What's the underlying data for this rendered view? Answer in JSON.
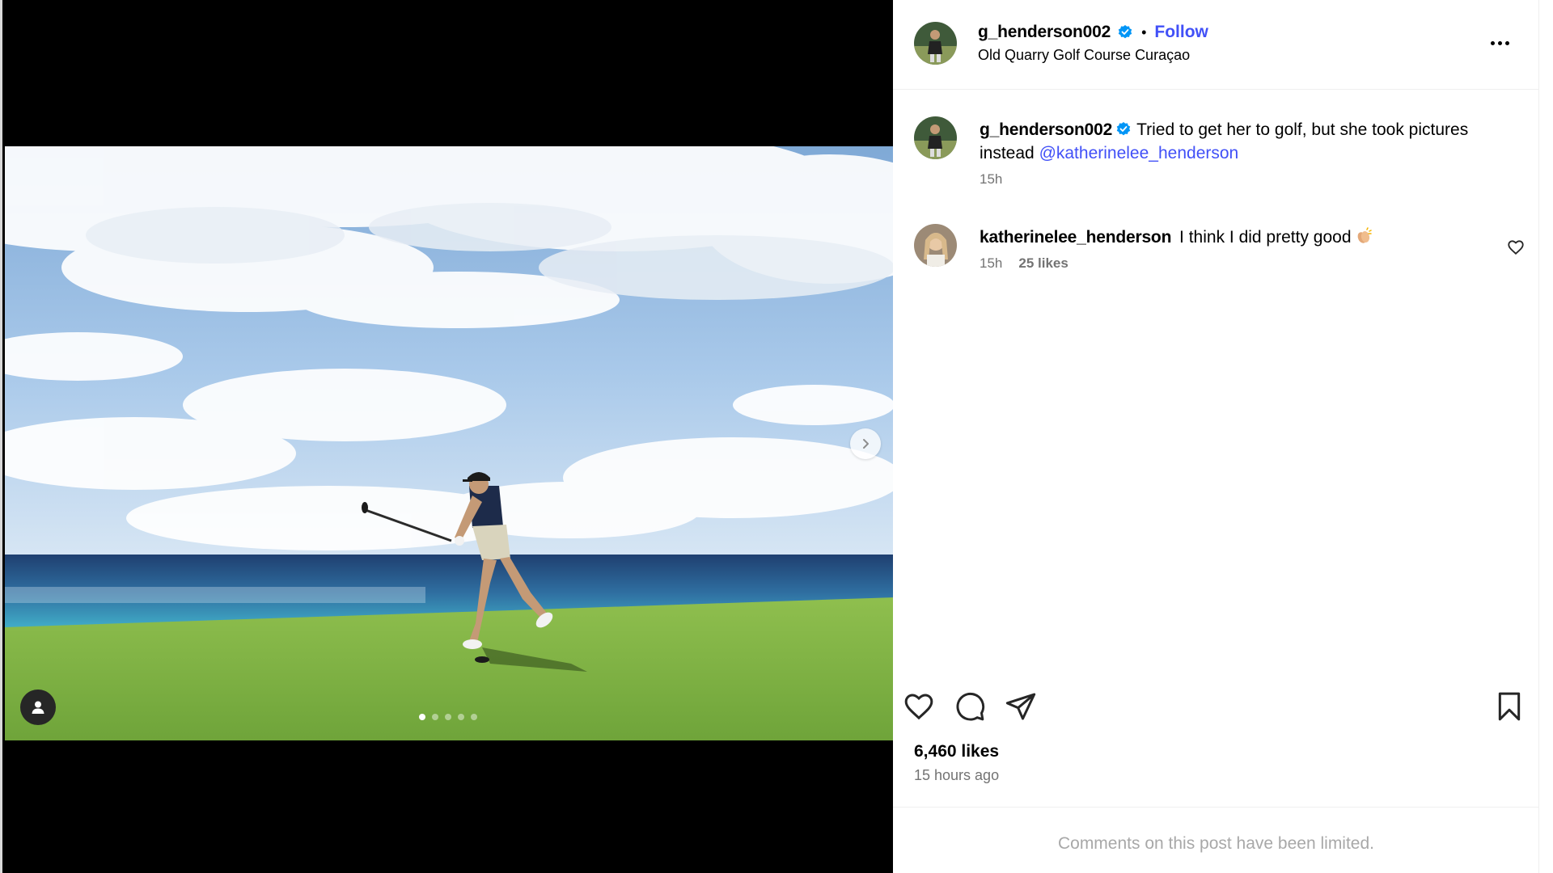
{
  "post": {
    "author": "g_henderson002",
    "location": "Old Quarry Golf Course Curaçao",
    "follow_label": "Follow",
    "separator": "•",
    "carousel": {
      "slide_count": 5,
      "active_index": 0
    }
  },
  "caption": {
    "username": "g_henderson002",
    "text": "Tried to get her to golf, but she took pictures instead ",
    "mention": "@katherinelee_henderson",
    "time": "15h"
  },
  "comments": [
    {
      "username": "katherinelee_henderson",
      "text": "I think I did pretty good",
      "emoji": "clapping-hands-emoji",
      "time": "15h",
      "likes": "25 likes"
    }
  ],
  "stats": {
    "likes": "6,460 likes",
    "posted": "15 hours ago"
  },
  "footer": {
    "limited_notice": "Comments on this post have been limited."
  },
  "colors": {
    "link": "#4150f7",
    "verified": "#0095f6",
    "muted": "#737373"
  }
}
